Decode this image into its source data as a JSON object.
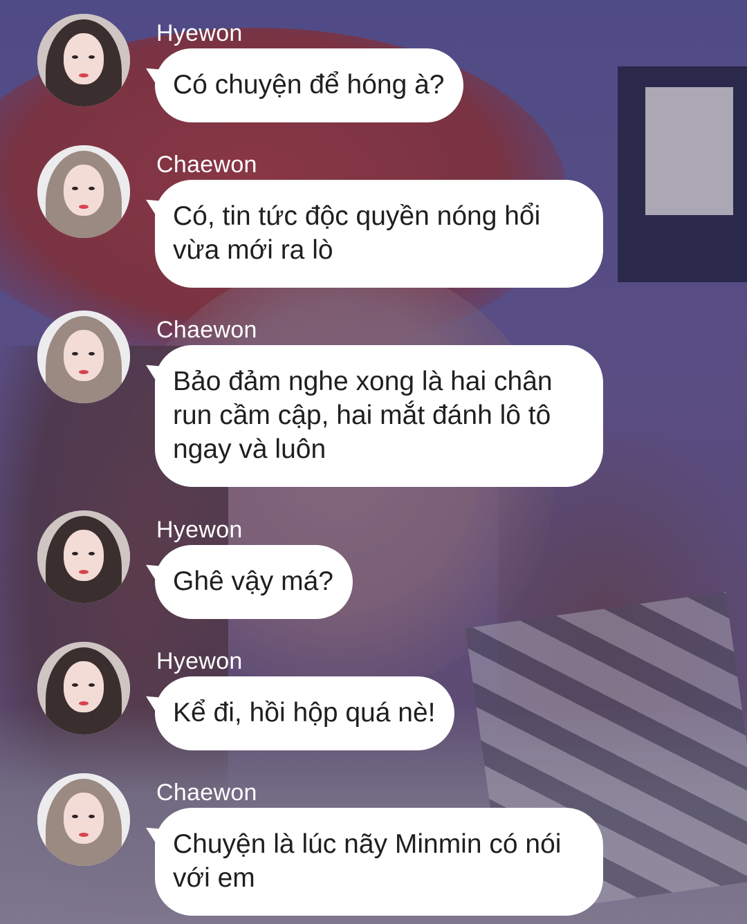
{
  "messages": [
    {
      "sender": "Hyewon",
      "avatar": "hyewon-avatar",
      "text": "Có chuyện để hóng à?"
    },
    {
      "sender": "Chaewon",
      "avatar": "chaewon-avatar",
      "text": "Có, tin tức độc quyền nóng hổi vừa mới ra lò"
    },
    {
      "sender": "Chaewon",
      "avatar": "chaewon-avatar",
      "text": "Bảo đảm nghe xong là hai chân run cầm cập, hai mắt đánh lô tô ngay và luôn"
    },
    {
      "sender": "Hyewon",
      "avatar": "hyewon-avatar",
      "text": "Ghê vậy má?"
    },
    {
      "sender": "Hyewon",
      "avatar": "hyewon-avatar",
      "text": "Kể đi, hồi hộp quá nè!"
    },
    {
      "sender": "Chaewon",
      "avatar": "chaewon-avatar",
      "text": "Chuyện là lúc nãy Minmin có nói với em"
    }
  ],
  "colors": {
    "bubble": "#ffffff",
    "bubble_text": "#1f1f1f",
    "sender_name": "#ffffff",
    "background_accent": "#5d5a9c"
  }
}
